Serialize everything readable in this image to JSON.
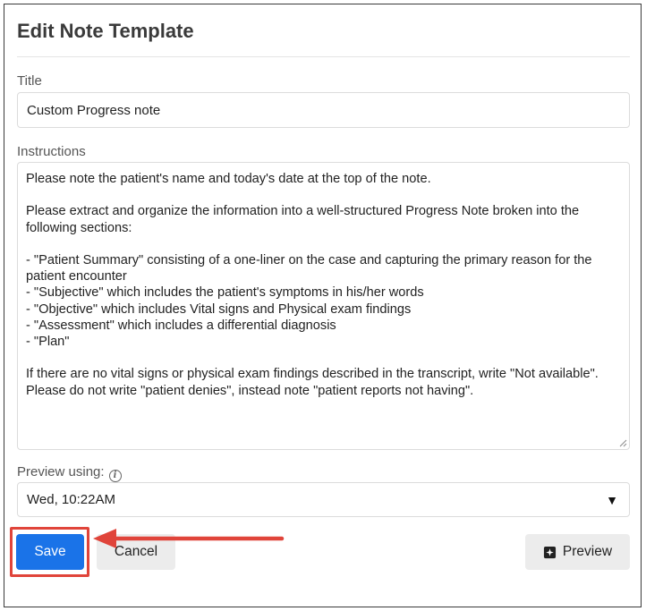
{
  "dialog": {
    "title": "Edit Note Template"
  },
  "form": {
    "title_label": "Title",
    "title_value": "Custom Progress note",
    "instructions_label": "Instructions",
    "instructions_value": "Please note the patient's name and today's date at the top of the note.\n\nPlease extract and organize the information into a well-structured Progress Note broken into the following sections:\n\n- \"Patient Summary\" consisting of a one-liner on the case and capturing the primary reason for the patient encounter\n- \"Subjective\" which includes the patient's symptoms in his/her words\n- \"Objective\" which includes Vital signs and Physical exam findings\n- \"Assessment\" which includes a differential diagnosis\n- \"Plan\"\n\nIf there are no vital signs or physical exam findings described in the transcript, write \"Not available\".\nPlease do not write \"patient denies\", instead note \"patient reports not having\".",
    "preview_label": "Preview using:",
    "preview_selected": "Wed, 10:22AM"
  },
  "actions": {
    "save_label": "Save",
    "cancel_label": "Cancel",
    "preview_label": "Preview"
  },
  "icons": {
    "info": "info-icon",
    "dropdown": "caret-down-icon",
    "preview": "preview-sparkle-icon"
  },
  "colors": {
    "primary": "#1a73e8",
    "annotation": "#e0443a",
    "secondary_button": "#ececec"
  }
}
